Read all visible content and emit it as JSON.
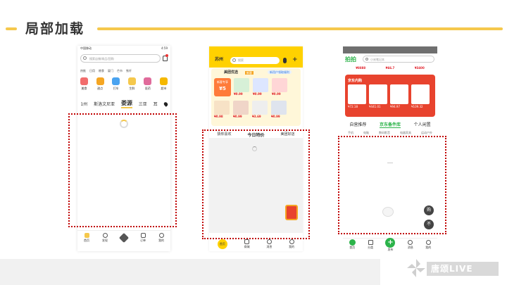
{
  "page": {
    "title": "局部加载",
    "brand": "唐颂LIVE"
  },
  "colors": {
    "accent": "#f5c84c",
    "highlight_border": "#c00000",
    "meituan_yellow": "#ffd100",
    "jd_red": "#e8432e",
    "paipai_green": "#2cb34a"
  },
  "phone1": {
    "status_left": "中国移动",
    "status_right": "4:59",
    "search_placeholder": "搜索店铺/商品/团购",
    "hot_words": [
      "热推",
      "日用",
      "粮食",
      "厦门",
      "芒市",
      "铁杆"
    ],
    "categories": [
      {
        "label": "美食",
        "color": "#f26d6d"
      },
      {
        "label": "甜点",
        "color": "#f5a623"
      },
      {
        "label": "打车",
        "color": "#4aa3f0"
      },
      {
        "label": "生鲜",
        "color": "#f5c84c"
      },
      {
        "label": "医药",
        "color": "#e06b9b"
      },
      {
        "label": "超市",
        "color": "#f5b800"
      }
    ],
    "tabs": [
      "1州",
      "斯洛文尼亚",
      "娄源",
      "三亚",
      "耳"
    ],
    "active_tab": "娄源",
    "nav": [
      "首页",
      "发现",
      "",
      "订单",
      "我的"
    ]
  },
  "phone2": {
    "city": "苏州",
    "search_placeholder": "搜索",
    "banner_title": "美团优选",
    "banner_badge": "新客",
    "banner_right": "新用户领取福利",
    "coupon_label": "新客专享",
    "coupon_value": "¥5",
    "prices": [
      "¥0.99",
      "¥0.99",
      "¥0.99",
      "¥0.98",
      "¥0.99",
      "¥3.69",
      "¥0.99"
    ],
    "tabs": [
      "猜你喜欢",
      "今日特价",
      "美团好店"
    ],
    "active_tab": "今日特价",
    "nav": [
      "首页",
      "商城",
      "消息",
      "我的"
    ]
  },
  "phone3": {
    "logo": "拍拍",
    "search_placeholder": "小米笔记本",
    "top_prices": [
      "¥8888",
      "¥66.7",
      "¥3400"
    ],
    "banner_title": "京东内购",
    "banner_prices": [
      "¥72.18",
      "¥441.01",
      "¥94.97",
      "¥109.32"
    ],
    "tabs": [
      "自营推荐",
      "京东备件库",
      "个人闲置"
    ],
    "active_tab": "京东备件库",
    "subtabs": [
      "手机",
      "电脑",
      "数码影音",
      "电器家具",
      "运动户外"
    ],
    "fab1": "购",
    "fab2": "不",
    "nav": [
      "首页",
      "分类",
      "发布",
      "消息",
      "我的"
    ]
  }
}
